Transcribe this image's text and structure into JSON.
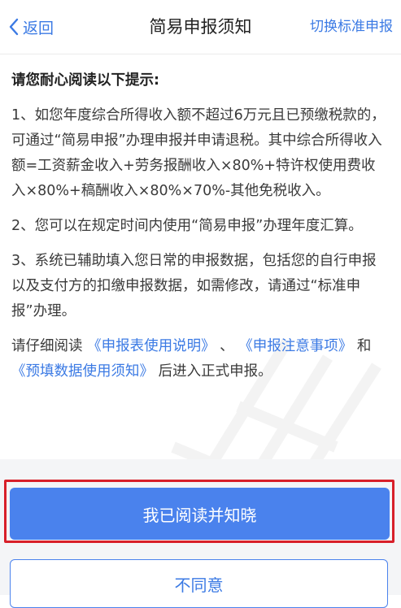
{
  "nav": {
    "back_label": "返回",
    "title": "简易申报须知",
    "switch_label": "切换标准申报"
  },
  "content": {
    "heading": "请您耐心阅读以下提示:",
    "para1": "1、如您年度综合所得收入额不超过6万元且已预缴税款的，可通过“简易申报”办理申报并申请退税。其中综合所得收入额=工资薪金收入+劳务报酬收入×80%+特许权使用费收入×80%+稿酬收入×80%×70%-其他免税收入。",
    "para2": "2、您可以在规定时间内使用“简易申报”办理年度汇算。",
    "para3": "3、系统已辅助填入您日常的申报数据，包括您的自行申报以及支付方的扣缴申报数据，如需修改，请通过“标准申报”办理。",
    "para4_prefix": "请仔细阅读",
    "link1": "《申报表使用说明》",
    "sep": "、",
    "link2": "《申报注意事项》",
    "and": "和",
    "link3": "《预填数据使用须知》",
    "para4_suffix": "后进入正式申报。"
  },
  "buttons": {
    "agree": "我已阅读并知晓",
    "disagree": "不同意"
  },
  "colors": {
    "accent": "#4a82ed",
    "link": "#3b7ae4",
    "highlight": "#d8202a"
  }
}
